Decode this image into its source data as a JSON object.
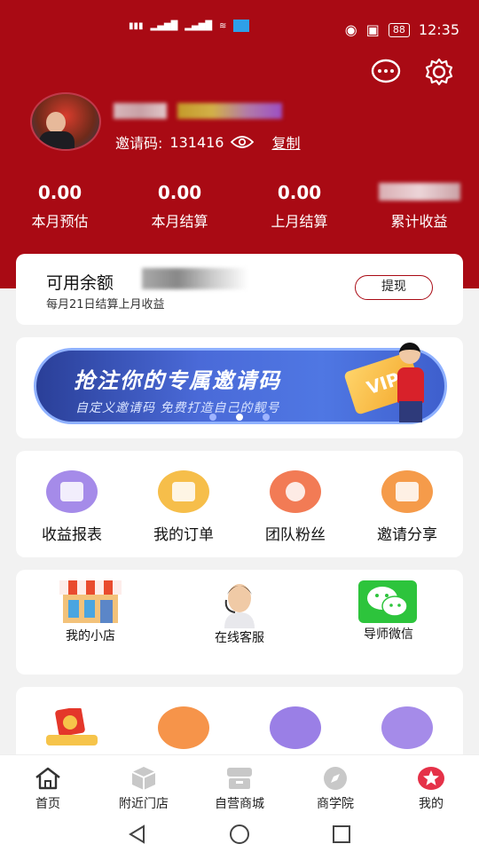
{
  "status_bar": {
    "time": "12:35",
    "battery": "88"
  },
  "profile": {
    "invite_label": "邀请码:",
    "invite_code": "131416",
    "copy_label": "复制"
  },
  "stats": [
    {
      "value": "0.00",
      "label": "本月预估"
    },
    {
      "value": "0.00",
      "label": "本月结算"
    },
    {
      "value": "0.00",
      "label": "上月结算"
    },
    {
      "value": "",
      "label": "累计收益"
    }
  ],
  "balance": {
    "title": "可用余额",
    "subtitle": "每月21日结算上月收益",
    "withdraw_label": "提现"
  },
  "banner": {
    "title": "抢注你的专属邀请码",
    "subtitle": "自定义邀请码 免费打造自己的靓号",
    "badge": "VIP"
  },
  "grid": [
    {
      "label": "收益报表",
      "color": "#9a7fe6"
    },
    {
      "label": "我的订单",
      "color": "#f6b23a"
    },
    {
      "label": "团队粉丝",
      "color": "#f16b45"
    },
    {
      "label": "邀请分享",
      "color": "#f48a3a"
    }
  ],
  "tools": [
    {
      "label": "我的小店"
    },
    {
      "label": "在线客服"
    },
    {
      "label": "导师微信"
    }
  ],
  "more_icons": [
    {
      "color": "#e53a2b"
    },
    {
      "color": "#f6913e"
    },
    {
      "color": "#8e72e0"
    },
    {
      "color": "#9c7fe6"
    }
  ],
  "bottom_nav": [
    {
      "label": "首页"
    },
    {
      "label": "附近门店"
    },
    {
      "label": "自营商城"
    },
    {
      "label": "商学院"
    },
    {
      "label": "我的"
    }
  ],
  "colors": {
    "brand": "#a90a14"
  }
}
